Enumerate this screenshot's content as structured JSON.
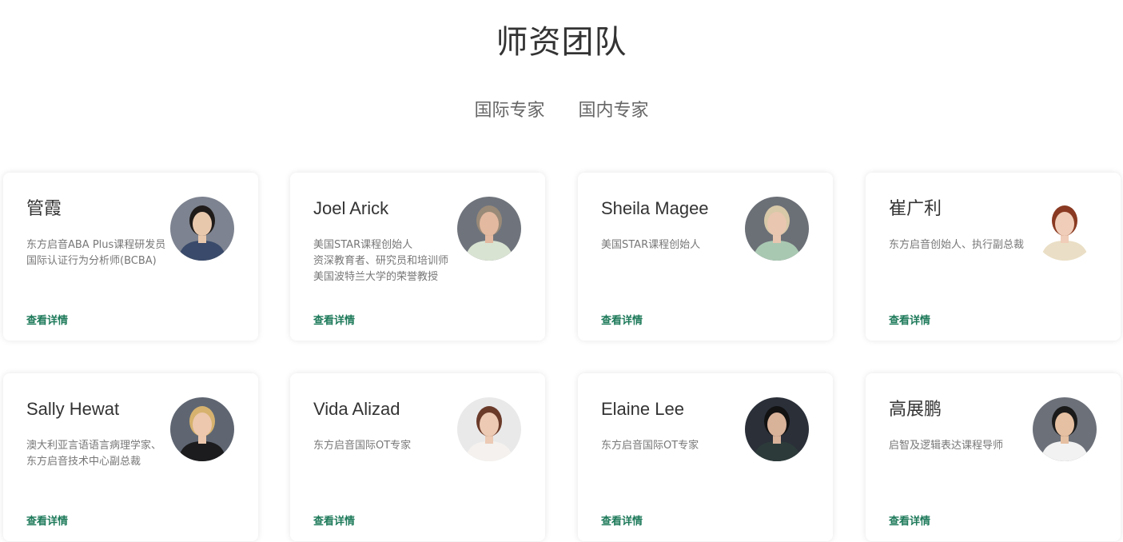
{
  "page": {
    "title": "师资团队",
    "tabs": [
      "国际专家",
      "国内专家"
    ]
  },
  "colors": {
    "accent": "#1e7a5a",
    "title": "#333333",
    "desc": "#777777"
  },
  "experts": [
    {
      "name": "管霞",
      "desc": "东方启音ABA Plus课程研发员 国际认证行为分析师(BCBA)",
      "link": "查看详情",
      "avatar": {
        "bg": "#7d8390",
        "skin": "#e8c8ad",
        "hair": "#1f1b1a",
        "cloth": "#3a4a6a"
      }
    },
    {
      "name": "Joel Arick",
      "desc": "美国STAR课程创始人\n资深教育者、研究员和培训师\n美国波特兰大学的荣誉教授",
      "link": "查看详情",
      "avatar": {
        "bg": "#6f747c",
        "skin": "#e3b9a0",
        "hair": "#9a8a78",
        "cloth": "#d9e3d2"
      }
    },
    {
      "name": "Sheila Magee",
      "desc": "美国STAR课程创始人",
      "link": "查看详情",
      "avatar": {
        "bg": "#6b6f76",
        "skin": "#e8c6b0",
        "hair": "#d8c9a8",
        "cloth": "#a9c8b2"
      }
    },
    {
      "name": "崔广利",
      "desc": "东方启音创始人、执行副总裁",
      "link": "查看详情",
      "avatar": {
        "bg": "#ffffff",
        "skin": "#f0cdb8",
        "hair": "#8a3a22",
        "cloth": "#eadfc6"
      }
    },
    {
      "name": "Sally Hewat",
      "desc": "澳大利亚言语语言病理学家、东方启音技术中心副总裁",
      "link": "查看详情",
      "avatar": {
        "bg": "#5f6672",
        "skin": "#edc8ae",
        "hair": "#d6b26e",
        "cloth": "#1c1c1e"
      }
    },
    {
      "name": "Vida Alizad",
      "desc": "东方启音国际OT专家",
      "link": "查看详情",
      "avatar": {
        "bg": "#e9e9ea",
        "skin": "#eccab4",
        "hair": "#6b3b2a",
        "cloth": "#f4f1ee"
      }
    },
    {
      "name": "Elaine Lee",
      "desc": "东方启音国际OT专家",
      "link": "查看详情",
      "avatar": {
        "bg": "#2a2f38",
        "skin": "#d9b29a",
        "hair": "#121212",
        "cloth": "#2c3a3a"
      }
    },
    {
      "name": "高展鹏",
      "desc": "启智及逻辑表达课程导师",
      "link": "查看详情",
      "avatar": {
        "bg": "#6c7079",
        "skin": "#e6c0a2",
        "hair": "#1a1a1a",
        "cloth": "#f2f2f2"
      }
    }
  ]
}
